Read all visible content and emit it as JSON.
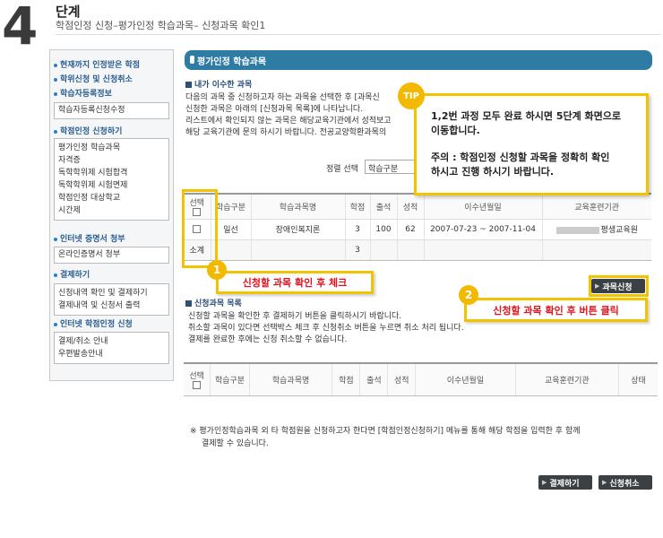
{
  "header": {
    "step_number": "4",
    "step_word": "단계",
    "subtitle": "학점인정 신청–평가인정 학습과목– 신청과목 확인1"
  },
  "sidebar": {
    "links_top": [
      "현재까지 인정받은 학점",
      "학위신청 및 신청취소",
      "학습자등록정보"
    ],
    "box1": [
      "학습자등록신청수정"
    ],
    "link_apply": "학점인정 신청하기",
    "box2": [
      "평가인정 학습과목",
      "자격증",
      "독학학위제 시험합격",
      "독학학위제 시험면제",
      "학점인정 대상학교",
      "시간제"
    ],
    "link_cert": "인터넷 증명서 청부",
    "box3": [
      "온라인증명서 청부"
    ],
    "link_pay": "결제하기",
    "box4": [
      "신청내역 확인 및 결제하기",
      "결제내역 및 신청서 출력"
    ],
    "link_net": "인터넷 학점인정 신청",
    "box5": [
      "결제/취소 안내",
      "우편발송안내"
    ]
  },
  "main": {
    "title": "평가인정 학습과목",
    "section1": {
      "title": "내가 이수한 과목",
      "lines": [
        "다음의 과목 중 신청하고자 하는 과목을 선택한 후 [과목신",
        "신청한 과목은 아래의 [신청과목 목록]에 나타납니다.",
        "리스트에서 확인되지 않는 과목은 해당교육기관에서 성적보고",
        "해당 교육기관에 문의 하시기 바랍니다. 전공교양학환과목의"
      ],
      "sort_label": "정렬 선택",
      "sort_value": "학습구분",
      "columns": [
        "선택",
        "학습구분",
        "학습과목명",
        "학점",
        "출석",
        "성적",
        "이수년월일",
        "교육훈련기관"
      ],
      "row": {
        "type": "일선",
        "name": "장애인복지론",
        "credit": "3",
        "attendance": "100",
        "score": "62",
        "period": "2007-07-23 ~ 2007-11-04",
        "institution": "평생교육원"
      },
      "subtotal_label": "소계",
      "subtotal_credit": "3",
      "apply_button": "과목신청"
    },
    "section2": {
      "title": "신청과목 목록",
      "lines": [
        "신청할 과목을 확인한 후 결제하기 버튼을 클릭하시기 바랍니다.",
        "취소할 과목이 있다면 선택박스 체크 후 신청취소 버튼을 누르면 취소 처리 됩니다.",
        "결제를 완료한 후에는 신청 취소할 수 없습니다."
      ],
      "columns": [
        "선택",
        "학습구분",
        "학습과목명",
        "학점",
        "출석",
        "성적",
        "이수년월일",
        "교육훈련기관",
        "상태"
      ]
    },
    "notice": [
      "※ 평가인정학습과목 외 타 학점원을 신청하고자 한다면 [학점인정신청하기] 메뉴를 통해 해당 학점을 입력한 후 함께",
      "결제할 수 있습니다."
    ],
    "pay_button": "결제하기",
    "cancel_button": "신청취소"
  },
  "tip": {
    "badge": "TIP",
    "line1": "1,2번 과정 모두 완료 하시면 5단계 화면으로",
    "line2": "이동합니다.",
    "line3": "주의 : 학점인정 신청할 과목을 정확히 확인",
    "line4": "하시고 진행 하시기 바랍니다."
  },
  "callouts": {
    "one_num": "1",
    "one_text": "신청할 과목 확인 후 체크",
    "two_num": "2",
    "two_text": "신청할 과목 확인 후 버튼 클릭"
  },
  "colors": {
    "accent": "#2e7ba4",
    "highlight": "#f2c400",
    "alert": "#e0141c"
  }
}
